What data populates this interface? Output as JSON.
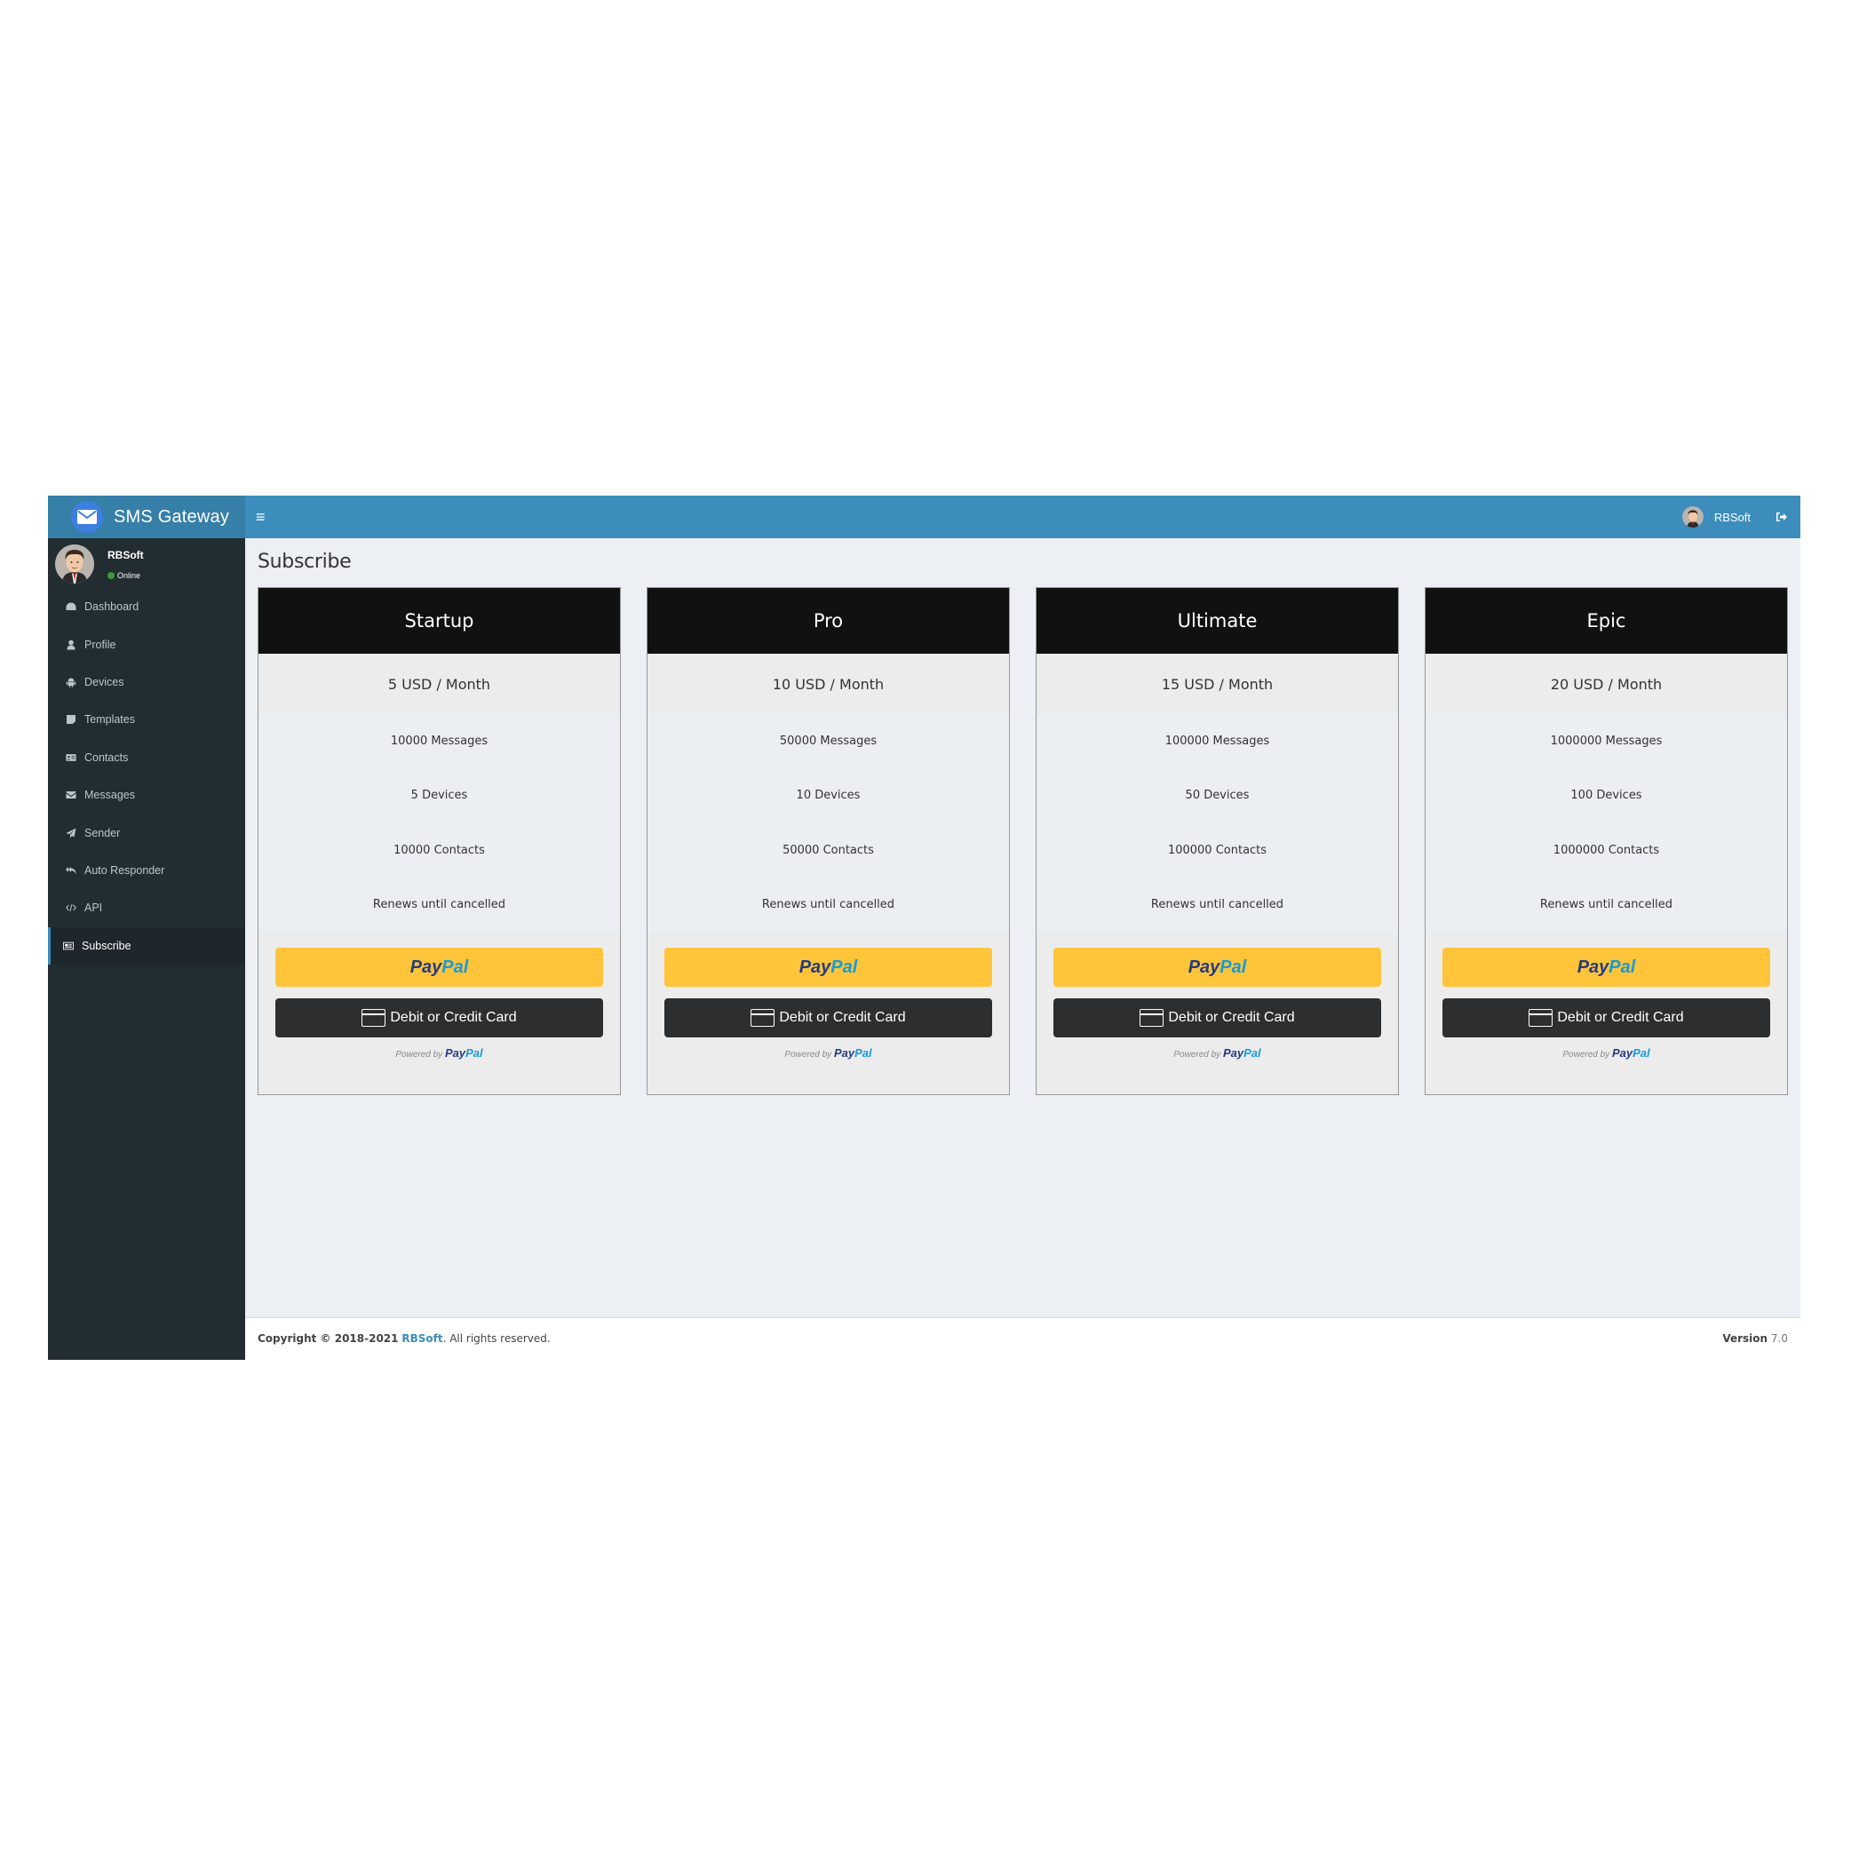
{
  "header": {
    "app_title": "SMS Gateway",
    "logo_icon": "envelope-icon",
    "toggle_icon": "hamburger-icon",
    "toggle_glyph": "≡",
    "user_name": "RBSoft",
    "logout_icon": "sign-out-icon"
  },
  "sidebar": {
    "user": {
      "name": "RBSoft",
      "status": "Online"
    },
    "items": [
      {
        "label": "Dashboard",
        "icon": "dashboard-icon",
        "active": false
      },
      {
        "label": "Profile",
        "icon": "user-icon",
        "active": false
      },
      {
        "label": "Devices",
        "icon": "android-icon",
        "active": false
      },
      {
        "label": "Templates",
        "icon": "sticky-note-icon",
        "active": false
      },
      {
        "label": "Contacts",
        "icon": "address-card-icon",
        "active": false
      },
      {
        "label": "Messages",
        "icon": "envelope-icon",
        "active": false
      },
      {
        "label": "Sender",
        "icon": "paper-plane-icon",
        "active": false
      },
      {
        "label": "Auto Responder",
        "icon": "reply-all-icon",
        "active": false
      },
      {
        "label": "API",
        "icon": "code-icon",
        "active": false
      },
      {
        "label": "Subscribe",
        "icon": "newspaper-icon",
        "active": true
      }
    ]
  },
  "page": {
    "title": "Subscribe"
  },
  "plans": [
    {
      "name": "Startup",
      "price": "5 USD / Month",
      "messages": "10000 Messages",
      "devices": "5 Devices",
      "contacts": "10000 Contacts",
      "renewal": "Renews until cancelled"
    },
    {
      "name": "Pro",
      "price": "10 USD / Month",
      "messages": "50000 Messages",
      "devices": "10 Devices",
      "contacts": "50000 Contacts",
      "renewal": "Renews until cancelled"
    },
    {
      "name": "Ultimate",
      "price": "15 USD / Month",
      "messages": "100000 Messages",
      "devices": "50 Devices",
      "contacts": "100000 Contacts",
      "renewal": "Renews until cancelled"
    },
    {
      "name": "Epic",
      "price": "20 USD / Month",
      "messages": "1000000 Messages",
      "devices": "100 Devices",
      "contacts": "1000000 Contacts",
      "renewal": "Renews until cancelled"
    }
  ],
  "payment": {
    "paypal_pay": "Pay",
    "paypal_pal": "Pal",
    "card_label": "Debit or Credit Card",
    "powered_by": "Powered by",
    "colors": {
      "paypal_yellow": "#ffc439",
      "paypal_dark_blue": "#253b80",
      "paypal_light_blue": "#179bd7",
      "card_button": "#2c2e2f"
    }
  },
  "footer": {
    "copyright_prefix": "Copyright © 2018-2021",
    "company_link": "RBSoft",
    "copyright_suffix": ". All rights reserved.",
    "version_label": "Version",
    "version_number": "7.0"
  },
  "colors": {
    "header": "#3c8dbc",
    "logo_bg": "#367fa9",
    "sidebar": "#222d32",
    "content_bg": "#ecf0f5",
    "card_header": "#111111"
  }
}
